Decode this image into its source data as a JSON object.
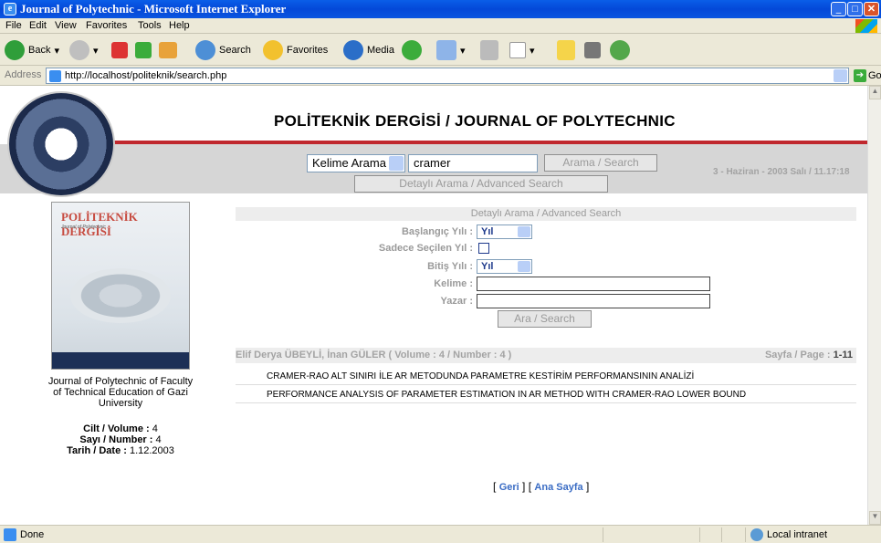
{
  "window": {
    "title": "Journal of Polytechnic - Microsoft Internet Explorer"
  },
  "menu": [
    "File",
    "Edit",
    "View",
    "Favorites",
    "Tools",
    "Help"
  ],
  "toolbar": {
    "back": "Back",
    "search": "Search",
    "favorites": "Favorites",
    "media": "Media"
  },
  "address": {
    "label": "Address",
    "url": "http://localhost/politeknik/search.php",
    "go": "Go"
  },
  "page": {
    "title": "POLİTEKNİK DERGİSİ / JOURNAL OF POLYTECHNIC",
    "search_type": "Kelime Arama",
    "query": "cramer",
    "search_btn": "Arama / Search",
    "adv_btn": "Detaylı Arama / Advanced Search",
    "date": "3 - Haziran - 2003 Salı / 11.17:18"
  },
  "cover": {
    "title": "POLİTEKNİK DERGİSİ",
    "subtitle": "Journal of Polytechnic"
  },
  "sidebar": {
    "desc": "Journal of Polytechnic of Faculty of Technical Education of Gazi University",
    "cilt_label": "Cilt / Volume :",
    "cilt": "4",
    "sayi_label": "Sayı / Number :",
    "sayi": "4",
    "tarih_label": "Tarih / Date :",
    "tarih": "1.12.2003"
  },
  "adv": {
    "heading": "Detaylı Arama / Advanced Search",
    "start_label": "Başlangıç Yılı :",
    "start_val": "Yıl",
    "only_label": "Sadece Seçilen Yıl :",
    "end_label": "Bitiş Yılı :",
    "end_val": "Yıl",
    "word_label": "Kelime :",
    "author_label": "Yazar :",
    "submit": "Ara / Search"
  },
  "results": {
    "heading": "Elif Derya ÜBEYLİ, İnan GÜLER ( Volume : 4 / Number : 4 )",
    "page_label": "Sayfa / Page :",
    "page_val": "1-11",
    "items": [
      "CRAMER-RAO ALT SINIRI İLE AR METODUNDA PARAMETRE KESTİRİM PERFORMANSININ ANALİZİ",
      "PERFORMANCE ANALYSIS OF PARAMETER ESTIMATION IN AR METHOD WITH CRAMER-RAO LOWER BOUND"
    ]
  },
  "links": {
    "back": "Geri",
    "home": "Ana Sayfa"
  },
  "status": {
    "text": "Done",
    "zone": "Local intranet"
  }
}
